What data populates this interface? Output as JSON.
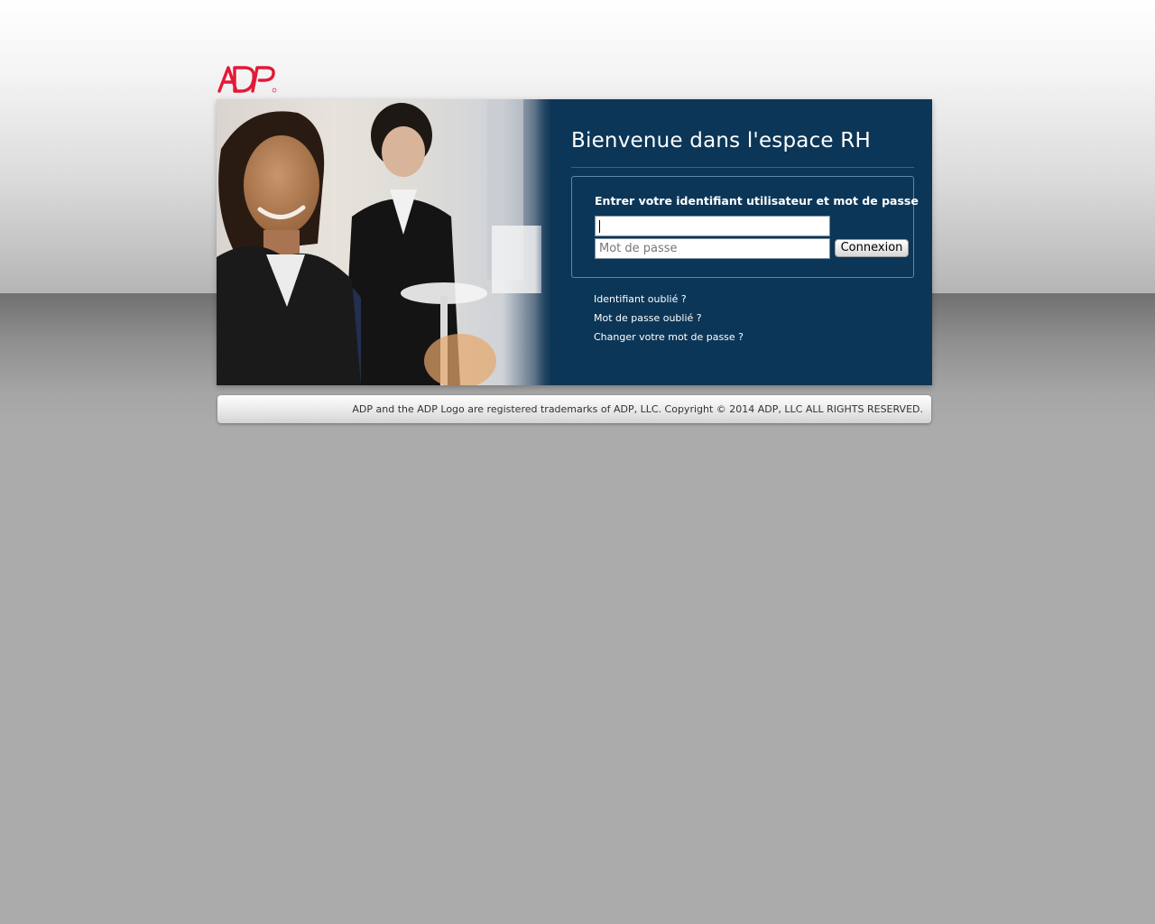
{
  "brand": {
    "logo_name": "ADP",
    "logo_color": "#e31937"
  },
  "colors": {
    "panel_bg": "#0c3657",
    "page_bg": "#ababab"
  },
  "header": {
    "title": "Bienvenue dans l'espace RH"
  },
  "login": {
    "instruction": "Entrer votre identifiant utilisateur et mot de passe",
    "username_value": "",
    "username_placeholder": "",
    "password_placeholder": "Mot de passe",
    "submit_label": "Connexion"
  },
  "links": [
    {
      "label": "Identifiant oublié ?"
    },
    {
      "label": "Mot de passe oublié ?"
    },
    {
      "label": "Changer votre mot de passe ?"
    }
  ],
  "footer": {
    "text": "ADP and the ADP Logo are registered trademarks of ADP, LLC. Copyright © 2014 ADP, LLC ALL RIGHTS RESERVED."
  }
}
